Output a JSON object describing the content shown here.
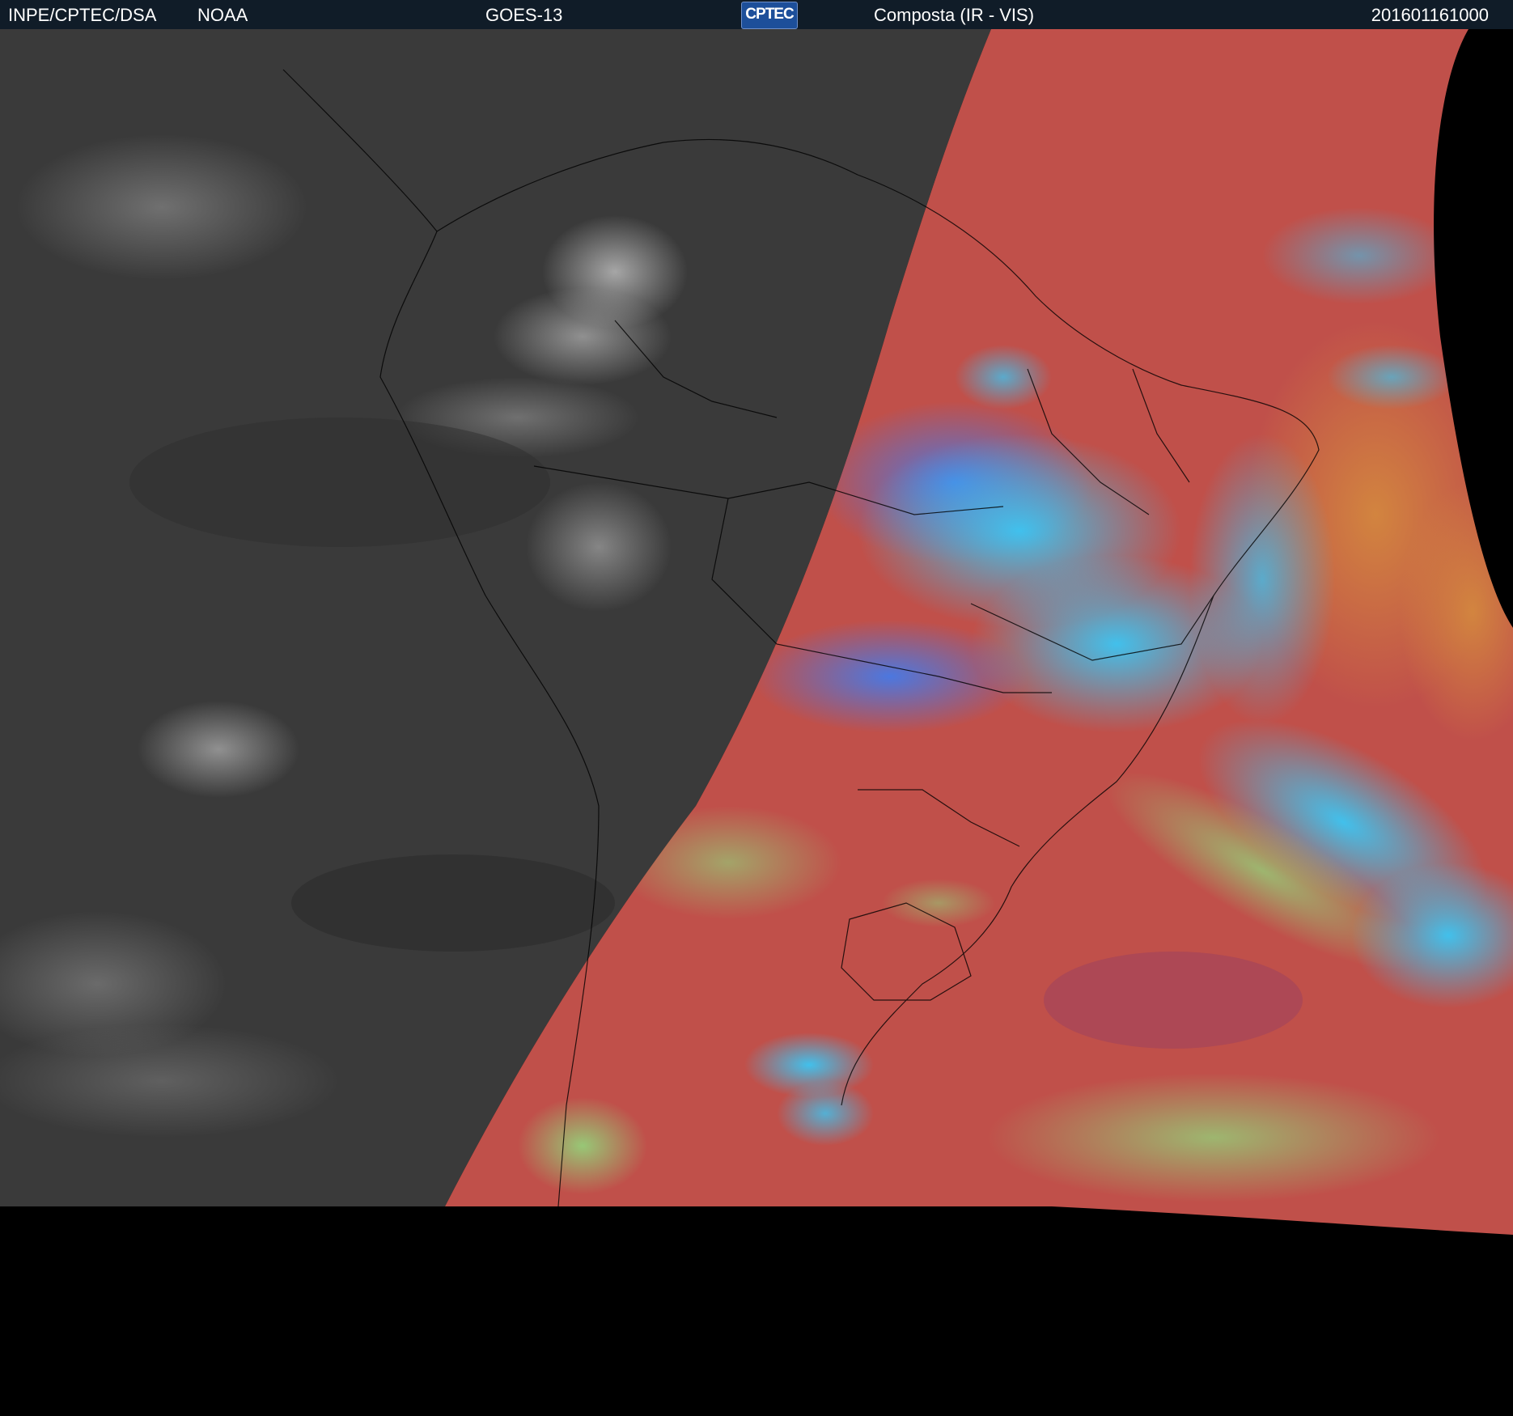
{
  "header": {
    "org": "INPE/CPTEC/DSA",
    "agency": "NOAA",
    "satellite": "GOES-13",
    "logo_text": "CPTEC",
    "product": "Composta (IR - VIS)",
    "timestamp": "201601161000"
  },
  "colors": {
    "header_bg": "#101c28",
    "night_ir": "#3a3a3a",
    "day_red": "#c0504a",
    "day_cyan": "#3ab8f0",
    "day_green": "#8ed07a",
    "background": "#000000"
  },
  "image": {
    "icon": "satellite-composite-image"
  }
}
